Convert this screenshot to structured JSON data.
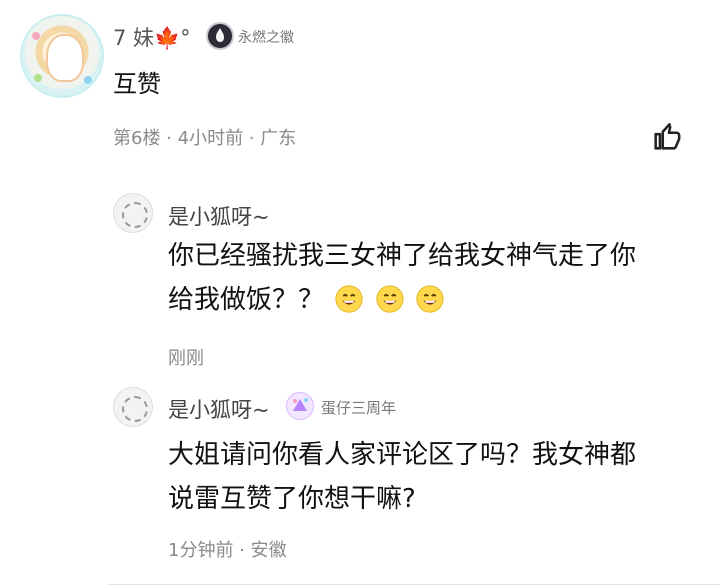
{
  "main_comment": {
    "username": "7 妹🍁°",
    "badge_text": "永燃之徽",
    "content": "互赞",
    "meta": "第6楼 · 4小时前 · 广东"
  },
  "replies": [
    {
      "username": "是小狐呀~",
      "content_line1": "你已经骚扰我三女神了给我女神气走了你",
      "content_line2": "给我做饭？？",
      "time": "刚刚"
    },
    {
      "username": "是小狐呀~",
      "badge_text": "蛋仔三周年",
      "content_line1": "大姐请问你看人家评论区了吗？我女神都",
      "content_line2": "说雷互赞了你想干嘛?",
      "meta": "1分钟前 · 安徽"
    }
  ],
  "icons": {
    "like": "thumb-up-icon",
    "emoji": "grinning-face-icon",
    "main_badge": "fire-badge-icon",
    "reply_badge": "party-badge-icon"
  },
  "colors": {
    "meta_gray": "#8a8a8a",
    "text_dark": "#111111",
    "username_gray": "#555555"
  }
}
